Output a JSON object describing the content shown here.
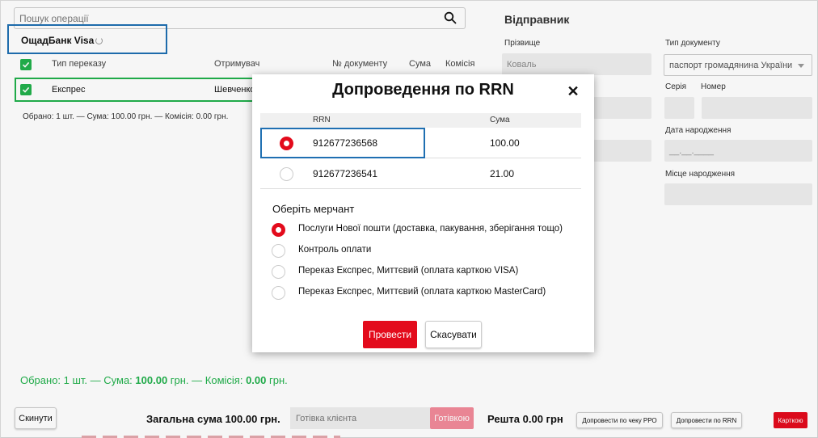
{
  "search": {
    "placeholder": "Пошук операції"
  },
  "bank": {
    "name": "ОщадБанк Visa"
  },
  "table": {
    "headers": [
      "Тип переказу",
      "Отримувач",
      "№ документу",
      "Сума",
      "Комісія"
    ],
    "row": {
      "type": "Експрес",
      "recipient": "Шевченко"
    }
  },
  "selection_summary_small": "Обрано: 1 шт. — Сума: 100.00 грн. — Комісія: 0.00 грн.",
  "selection_summary": {
    "prefix": "Обрано: 1 шт. — Сума: ",
    "sum": "100.00",
    "middle": " грн. — Комісія: ",
    "fee": "0.00",
    "suffix": " грн."
  },
  "footer": {
    "reset_label": "Скинути",
    "total_label": "Загальна сума 100.00 грн.",
    "cash_placeholder": "Готівка клієнта",
    "cash_button": "Готівкою",
    "change_label": "Решта 0.00 грн",
    "rro_button": "Допровести по чеку РРО",
    "rrn_button": "Допровести по RRN",
    "card_button": "Карткою"
  },
  "sender": {
    "title": "Відправник",
    "surname_label": "Прізвище",
    "surname_value": "Коваль",
    "doc_type_label": "Тип документу",
    "doc_type_value": "паспорт громадянина України",
    "series_label": "Серія",
    "number_label": "Номер",
    "birth_date_label": "Дата народження",
    "birth_date_placeholder": "__.__.____",
    "birth_place_label": "Місце народження"
  },
  "modal": {
    "title": "Допроведення по RRN",
    "close_icon": "✕",
    "col_rrn": "RRN",
    "col_sum": "Сума",
    "rows": [
      {
        "rrn": "912677236568",
        "sum": "100.00",
        "selected": true
      },
      {
        "rrn": "912677236541",
        "sum": "21.00",
        "selected": false
      }
    ],
    "merchant_title": "Оберіть мерчант",
    "merchants": [
      {
        "label": "Послуги Нової пошти (доставка, пакування, зберігання тощо)",
        "selected": true
      },
      {
        "label": "Контроль оплати",
        "selected": false
      },
      {
        "label": "Переказ Експрес, Миттєвий (оплата карткою VISA)",
        "selected": false
      },
      {
        "label": "Переказ Експрес, Миттєвий (оплата карткою MasterCard)",
        "selected": false
      }
    ],
    "submit_label": "Провести",
    "cancel_label": "Скасувати"
  },
  "colors": {
    "accent_red": "#e30b1c",
    "success_green": "#22b14c",
    "highlight_blue": "#1f6fb2"
  }
}
